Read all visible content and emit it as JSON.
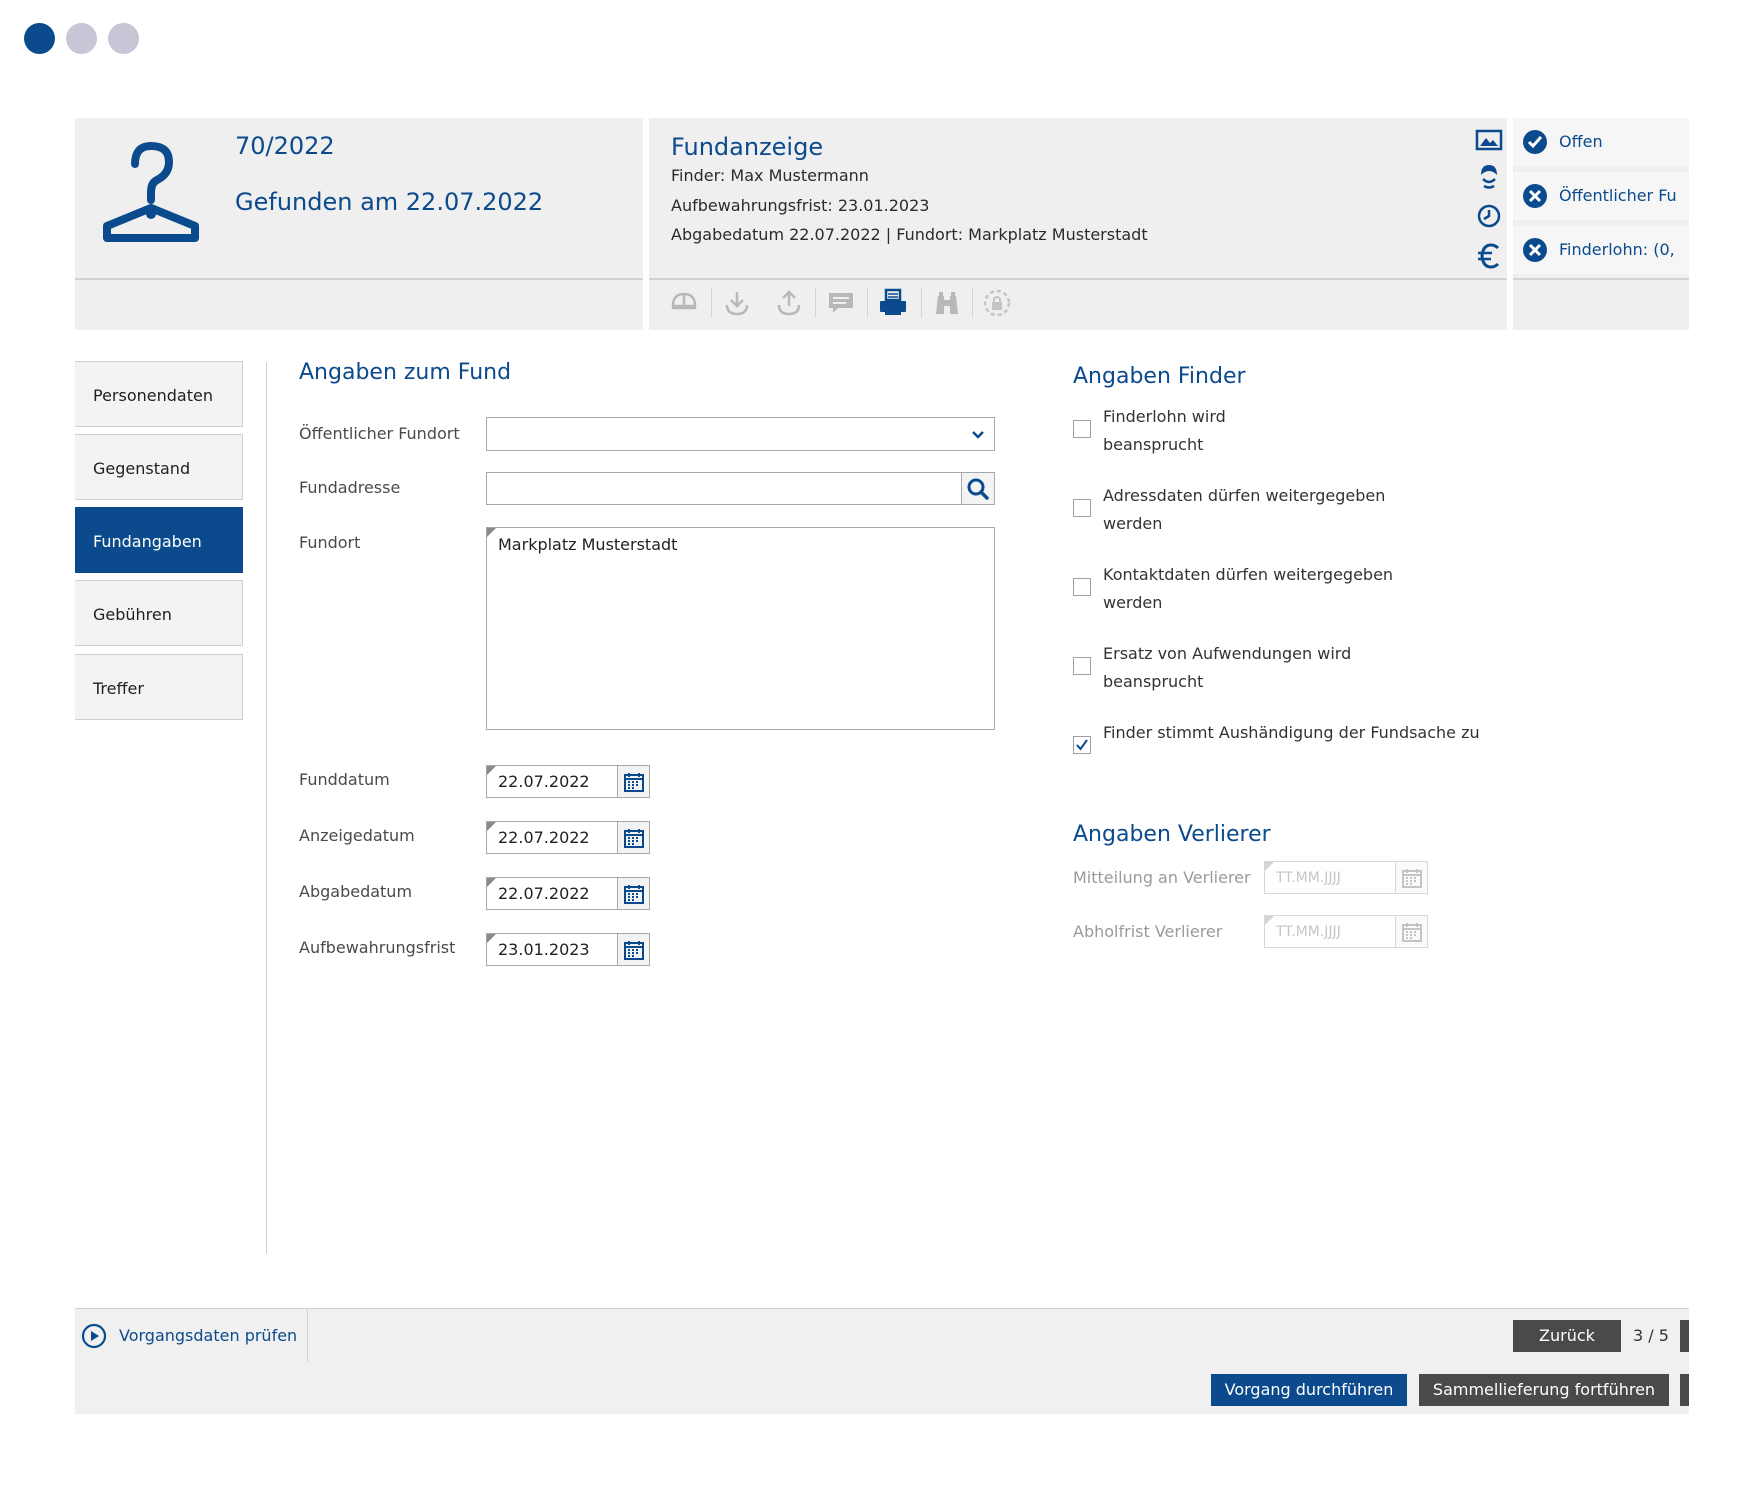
{
  "window": {
    "dots": [
      "#0b4a8c",
      "#c6c6d6",
      "#c6c6d6"
    ]
  },
  "header": {
    "case_number": "70/2022",
    "found_on": "Gefunden am 22.07.2022"
  },
  "report": {
    "title": "Fundanzeige",
    "finder": "Finder: Max Mustermann",
    "retention": "Aufbewahrungsfrist: 23.01.2023",
    "delivery": "Abgabedatum 22.07.2022 | Fundort: Markplatz Musterstadt",
    "side_icons": [
      "image-icon",
      "person-icon",
      "clock-icon",
      "euro-icon"
    ],
    "toolbar_icons": [
      "helmet-icon",
      "download-icon",
      "upload-icon",
      "comment-icon",
      "print-icon",
      "binoculars-icon",
      "lock-settings-icon"
    ]
  },
  "status": {
    "items": [
      {
        "label": "Offen",
        "icon": "check-circle-icon"
      },
      {
        "label": "Öffentlicher Fu",
        "icon": "x-circle-icon"
      },
      {
        "label": "Finderlohn: (0,",
        "icon": "x-circle-icon"
      }
    ]
  },
  "nav": {
    "items": [
      "Personendaten",
      "Gegenstand",
      "Fundangaben",
      "Gebühren",
      "Treffer"
    ],
    "active": "Fundangaben"
  },
  "fund": {
    "heading": "Angaben zum Fund",
    "public_location_label": "Öffentlicher Fundort",
    "public_location_value": "",
    "address_label": "Fundadresse",
    "address_value": "",
    "location_label": "Fundort",
    "location_value": "Markplatz Musterstadt",
    "dates": [
      {
        "label": "Funddatum",
        "value": "22.07.2022"
      },
      {
        "label": "Anzeigedatum",
        "value": "22.07.2022"
      },
      {
        "label": "Abgabedatum",
        "value": "22.07.2022"
      },
      {
        "label": "Aufbewahrungsfrist",
        "value": "23.01.2023"
      }
    ]
  },
  "finder": {
    "heading": "Angaben Finder",
    "checkboxes": [
      {
        "label": "Finderlohn wird beansprucht",
        "checked": false
      },
      {
        "label": "Adressdaten dürfen weitergegeben werden",
        "checked": false
      },
      {
        "label": "Kontaktdaten dürfen weitergegeben werden",
        "checked": false
      },
      {
        "label": "Ersatz von Aufwendungen wird beansprucht",
        "checked": false
      },
      {
        "label": "Finder stimmt Aushändigung der Fundsache zu",
        "checked": true
      }
    ]
  },
  "loser": {
    "heading": "Angaben Verlierer",
    "fields": [
      {
        "label": "Mitteilung an Verlierer",
        "placeholder": "TT.MM.JJJJ"
      },
      {
        "label": "Abholfrist Verlierer",
        "placeholder": "TT.MM.JJJJ"
      }
    ]
  },
  "footer": {
    "check_label": "Vorgangsdaten prüfen",
    "back_label": "Zurück",
    "page_indicator": "3 / 5",
    "execute_label": "Vorgang durchführen",
    "continue_label": "Sammellieferung fortführen"
  },
  "colors": {
    "accent": "#0b4a8c",
    "button_dark": "#4a4a4a",
    "panel": "#efefef"
  }
}
